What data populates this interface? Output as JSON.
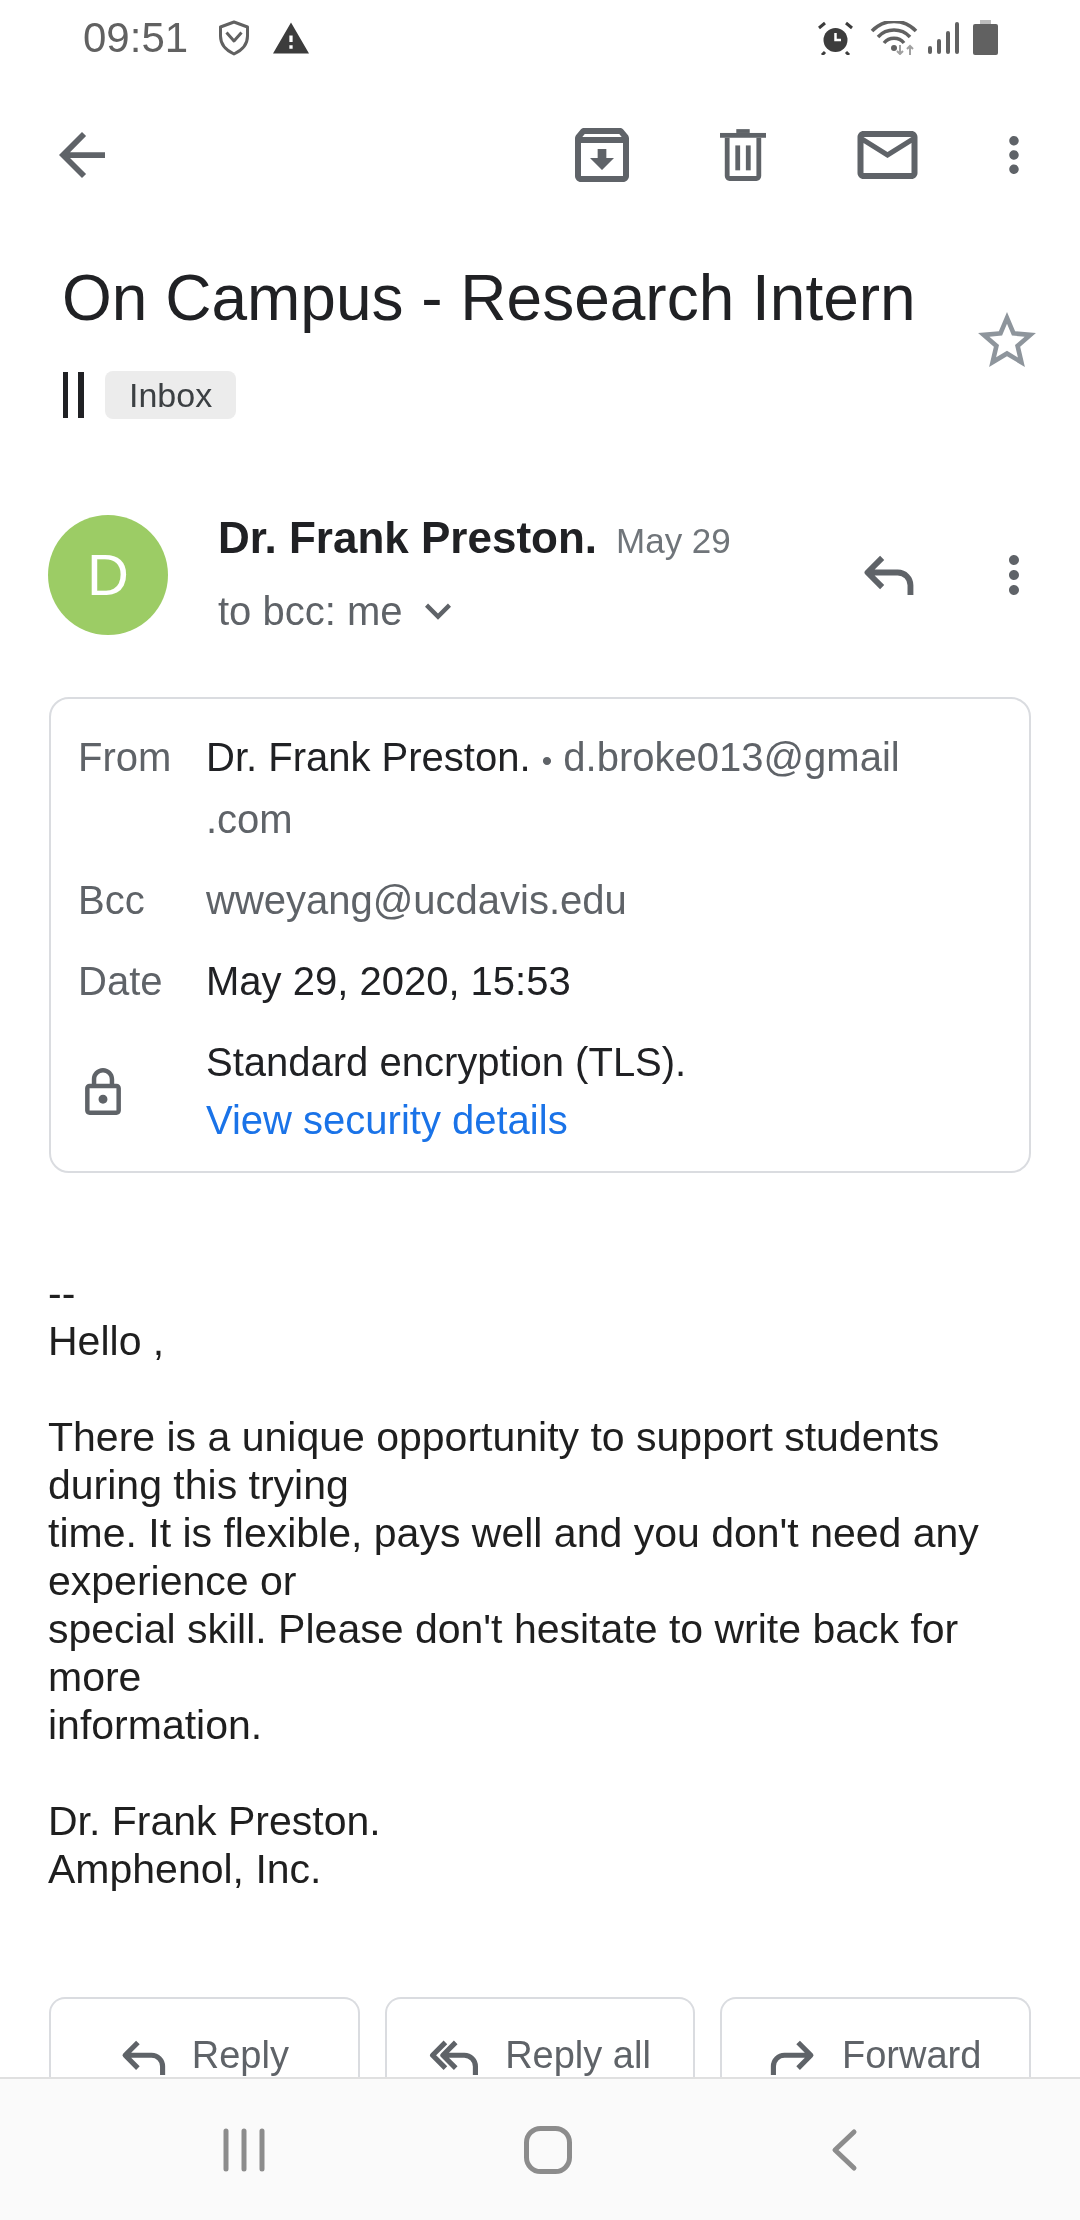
{
  "status_bar": {
    "time": "09:51"
  },
  "message": {
    "subject": "On Campus - Research Intern",
    "labels": [
      "Inbox"
    ],
    "starred": false
  },
  "sender": {
    "initial": "D",
    "name": "Dr. Frank Preston.",
    "date": "May 29",
    "recipients": "to bcc: me"
  },
  "details": [
    {
      "kind": "from",
      "label": "From",
      "name": "Dr. Frank Preston.",
      "separator": "•",
      "email": "d.broke013@gmail.com"
    },
    {
      "kind": "address",
      "label": "Bcc",
      "value": "wweyang@ucdavis.edu"
    },
    {
      "kind": "text",
      "label": "Date",
      "value": "May 29, 2020, 15:53"
    },
    {
      "kind": "security",
      "text": "Standard encryption (TLS).",
      "link": "View security details"
    }
  ],
  "body": {
    "paragraphs": [
      [
        "--",
        "Hello ,"
      ],
      [
        "There is a unique opportunity to support students during this trying",
        "time. It is flexible, pays well and you don't need any experience or",
        "special skill. Please don't hesitate to write back for more",
        "information."
      ],
      [
        "Dr. Frank Preston.",
        "Amphenol, Inc."
      ]
    ]
  },
  "actions": [
    {
      "kind": "reply",
      "label": "Reply"
    },
    {
      "kind": "reply_all",
      "label": "Reply all"
    },
    {
      "kind": "forward",
      "label": "Forward"
    }
  ]
}
